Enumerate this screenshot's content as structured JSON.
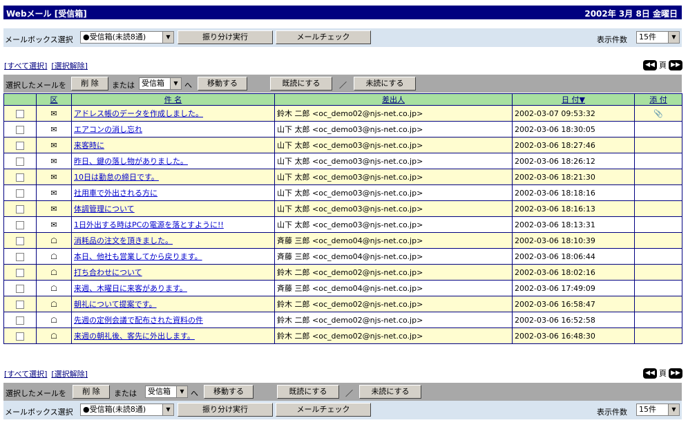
{
  "title": {
    "left": "Webメール [受信箱]",
    "right": "2002年 3月 8日  金曜日"
  },
  "mailbox_bar": {
    "label": "メールボックス選択",
    "mailbox_value": "●受信箱(未読8通)",
    "sort_button": "振り分け実行",
    "check_button": "メールチェック",
    "count_label": "表示件数",
    "count_value": "15件"
  },
  "links": {
    "select_all": "[すべて選択]",
    "deselect": "[選択解除]"
  },
  "pager": {
    "first": "◀◀",
    "page": "頁",
    "last": "▶▶"
  },
  "action_bar": {
    "selected_label": "選択したメールを",
    "delete": "削 除",
    "or": "または",
    "folder_value": "受信箱",
    "to": "へ",
    "move": "移動する",
    "mark_read": "既読にする",
    "slash": "／",
    "mark_unread": "未読にする"
  },
  "table": {
    "headers": {
      "check": "",
      "kind": "区",
      "subject": "件 名",
      "sender": "差出人",
      "date": "日 付▼",
      "attach": "添 付"
    },
    "rows": [
      {
        "icon": "✉",
        "subject": "アドレス帳のデータを作成しました。",
        "sender": "鈴木  二郎 <oc_demo02@njs-net.co.jp>",
        "date": "2002-03-07 09:53:32",
        "attach": "📎"
      },
      {
        "icon": "✉",
        "subject": "エアコンの消し忘れ",
        "sender": "山下  太郎 <oc_demo03@njs-net.co.jp>",
        "date": "2002-03-06 18:30:05",
        "attach": ""
      },
      {
        "icon": "✉",
        "subject": "来客時に",
        "sender": "山下  太郎 <oc_demo03@njs-net.co.jp>",
        "date": "2002-03-06 18:27:46",
        "attach": ""
      },
      {
        "icon": "✉",
        "subject": "昨日、鍵の落し物がありました。",
        "sender": "山下  太郎 <oc_demo03@njs-net.co.jp>",
        "date": "2002-03-06 18:26:12",
        "attach": ""
      },
      {
        "icon": "✉",
        "subject": "10日は勤怠の締日です。",
        "sender": "山下  太郎 <oc_demo03@njs-net.co.jp>",
        "date": "2002-03-06 18:21:30",
        "attach": ""
      },
      {
        "icon": "✉",
        "subject": "社用車で外出される方に",
        "sender": "山下  太郎 <oc_demo03@njs-net.co.jp>",
        "date": "2002-03-06 18:18:16",
        "attach": ""
      },
      {
        "icon": "✉",
        "subject": "体調管理について",
        "sender": "山下  太郎 <oc_demo03@njs-net.co.jp>",
        "date": "2002-03-06 18:16:13",
        "attach": ""
      },
      {
        "icon": "✉",
        "subject": "1日外出する時はPCの電源を落とすように!!",
        "sender": "山下  太郎 <oc_demo03@njs-net.co.jp>",
        "date": "2002-03-06 18:13:31",
        "attach": ""
      },
      {
        "icon": "☖",
        "subject": "消耗品の注文を頂きました。",
        "sender": "斉藤  三郎 <oc_demo04@njs-net.co.jp>",
        "date": "2002-03-06 18:10:39",
        "attach": ""
      },
      {
        "icon": "☖",
        "subject": "本日、他社も営業してから戻ります。",
        "sender": "斉藤  三郎 <oc_demo04@njs-net.co.jp>",
        "date": "2002-03-06 18:06:44",
        "attach": ""
      },
      {
        "icon": "☖",
        "subject": "打ち合わせについて",
        "sender": "鈴木  二郎 <oc_demo02@njs-net.co.jp>",
        "date": "2002-03-06 18:02:16",
        "attach": ""
      },
      {
        "icon": "☖",
        "subject": "来週、木曜日に来客があります。",
        "sender": "斉藤  三郎 <oc_demo04@njs-net.co.jp>",
        "date": "2002-03-06 17:49:09",
        "attach": ""
      },
      {
        "icon": "☖",
        "subject": "朝礼について提案です。",
        "sender": "鈴木  二郎 <oc_demo02@njs-net.co.jp>",
        "date": "2002-03-06 16:58:47",
        "attach": ""
      },
      {
        "icon": "☖",
        "subject": "先週の定例会議で配布された資料の件",
        "sender": "鈴木  二郎 <oc_demo02@njs-net.co.jp>",
        "date": "2002-03-06 16:52:58",
        "attach": ""
      },
      {
        "icon": "☖",
        "subject": "来週の朝礼後、客先に外出します。",
        "sender": "鈴木  二郎 <oc_demo02@njs-net.co.jp>",
        "date": "2002-03-06 16:48:30",
        "attach": ""
      }
    ]
  }
}
